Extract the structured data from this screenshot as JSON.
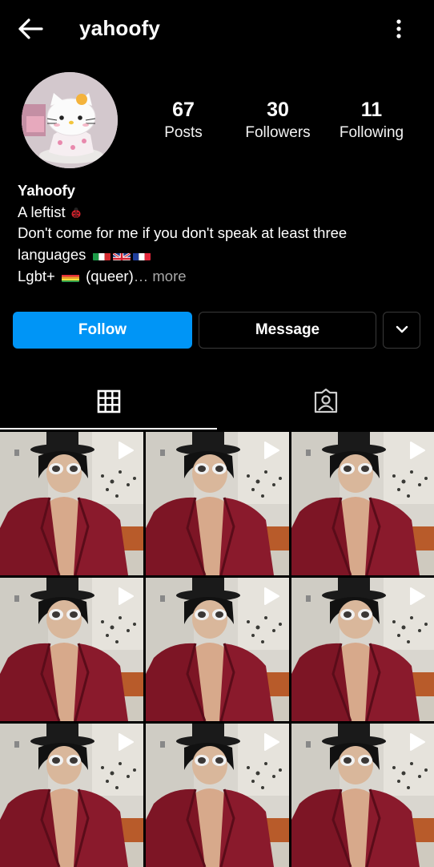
{
  "header": {
    "username": "yahoofy",
    "back_icon": "arrow-left-icon",
    "menu_icon": "more-vertical-icon"
  },
  "profile": {
    "avatar_alt": "hello-kitty-avatar",
    "stats": [
      {
        "value": "67",
        "label": "Posts"
      },
      {
        "value": "30",
        "label": "Followers"
      },
      {
        "value": "11",
        "label": "Following"
      }
    ],
    "display_name": "Yahoofy",
    "bio_line1": "A leftist",
    "bio_line2": "Don't come for me if you don't speak at least three",
    "bio_line3": "languages",
    "bio_line4_prefix": "Lgbt+",
    "bio_line4_text": "(queer)",
    "more_label": "… more"
  },
  "actions": {
    "follow_label": "Follow",
    "message_label": "Message",
    "dropdown_icon": "chevron-down-icon"
  },
  "tabs": [
    {
      "icon": "grid-icon",
      "active": true
    },
    {
      "icon": "tagged-person-icon",
      "active": false
    }
  ],
  "colors": {
    "background": "#000000",
    "accent": "#0095f6",
    "muted_text": "#a8a8a8",
    "button_border": "#3a3a3a"
  },
  "posts": {
    "type": "reel",
    "icon": "play-icon",
    "visible_count": 9
  }
}
